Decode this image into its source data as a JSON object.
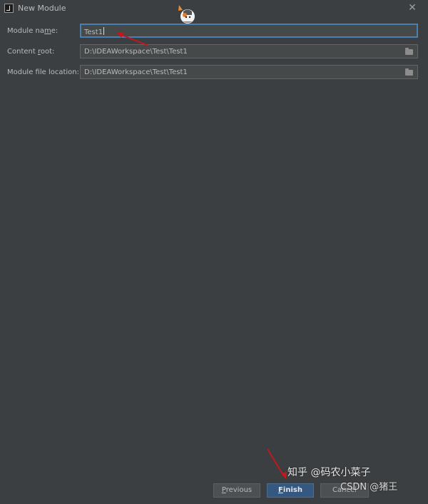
{
  "window": {
    "title": "New Module",
    "close_glyph": "✕"
  },
  "form": {
    "module_name": {
      "label_prefix": "Module na",
      "label_mnemonic": "m",
      "label_suffix": "e:",
      "value": "Test1"
    },
    "content_root": {
      "label_prefix": "Content ",
      "label_mnemonic": "r",
      "label_suffix": "oot:",
      "value": "D:\\IDEAWorkspace\\Test\\Test1"
    },
    "module_file_location": {
      "label_prefix": "Module file location:",
      "value": "D:\\IDEAWorkspace\\Test\\Test1"
    }
  },
  "buttons": {
    "previous_mnemonic": "P",
    "previous_rest": "revious",
    "finish_mnemonic": "F",
    "finish_rest": "inish",
    "cancel_label": "Cancel"
  },
  "watermark": {
    "line1": "知乎 @码农小菜子",
    "line2": "CSDN @猪王"
  },
  "colors": {
    "background": "#3c3f41",
    "field_bg": "#45494a",
    "focus_border": "#4a7fb1",
    "finish_bg": "#365880",
    "annotation_arrow": "#c0181c"
  },
  "icons": [
    "intellij-icon",
    "close-icon",
    "folder-icon",
    "mascot-sticker"
  ]
}
